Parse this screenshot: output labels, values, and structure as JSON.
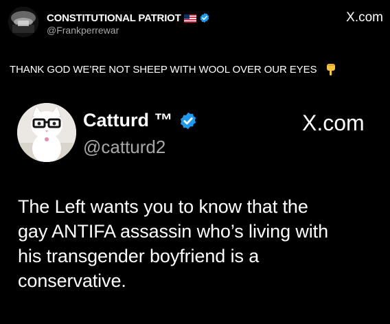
{
  "outer_post": {
    "display_name": "CONSTITUTIONAL PATRIOT",
    "flag_icon": "us-flag-icon",
    "verified_icon": "verified-badge-icon",
    "verified_color": "#1d9bf0",
    "handle": "@Frankperrewar",
    "source": "X.com",
    "text": "THANK GOD WE’RE NOT SHEEP WITH WOOL OVER OUR EYES",
    "emoji_icon": "pointing-down-hand-icon"
  },
  "quoted_post": {
    "display_name": "Catturd ™",
    "verified_icon": "verified-badge-icon",
    "handle": "@catturd2",
    "source": "X.com",
    "text_lines": [
      "The Left wants you to know that the",
      "gay ANTIFA assassin who’s living with",
      "his transgender boyfriend is a",
      "conservative."
    ]
  }
}
